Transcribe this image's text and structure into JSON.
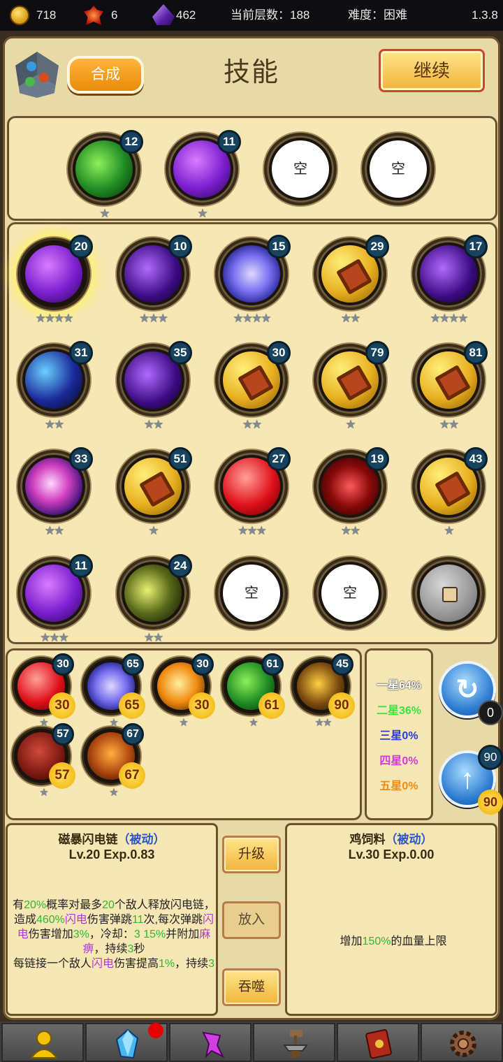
{
  "topbar": {
    "gold": "718",
    "fire_gems": "6",
    "crystals": "462",
    "floor_label": "当前层数：188",
    "difficulty_label": "难度：困难",
    "version": "1.3.8"
  },
  "header": {
    "synth_label": "合成",
    "title": "技能",
    "continue_label": "继续"
  },
  "equipped": [
    {
      "level": "12",
      "stars": "★",
      "style": "green"
    },
    {
      "level": "11",
      "stars": "★",
      "style": "purple"
    },
    {
      "empty": "空"
    },
    {
      "empty": "空"
    }
  ],
  "inventory": [
    {
      "level": "20",
      "stars": "★★★★",
      "style": "purple",
      "selected": true
    },
    {
      "level": "10",
      "stars": "★★★",
      "style": "darkpurple"
    },
    {
      "level": "15",
      "stars": "★★★★",
      "style": "blue"
    },
    {
      "level": "29",
      "stars": "★★",
      "style": "gold"
    },
    {
      "level": "17",
      "stars": "★★★★",
      "style": "darkpurple"
    },
    {
      "level": "31",
      "stars": "★★",
      "style": "darkblue"
    },
    {
      "level": "35",
      "stars": "★★",
      "style": "darkpurple"
    },
    {
      "level": "30",
      "stars": "★★",
      "style": "gold"
    },
    {
      "level": "79",
      "stars": "★",
      "style": "gold"
    },
    {
      "level": "81",
      "stars": "★★",
      "style": "gold"
    },
    {
      "level": "33",
      "stars": "★★",
      "style": "violet"
    },
    {
      "level": "51",
      "stars": "★",
      "style": "gold"
    },
    {
      "level": "27",
      "stars": "★★★",
      "style": "red"
    },
    {
      "level": "19",
      "stars": "★★",
      "style": "redblack"
    },
    {
      "level": "43",
      "stars": "★",
      "style": "gold"
    },
    {
      "level": "11",
      "stars": "★★★",
      "style": "purple"
    },
    {
      "level": "24",
      "stars": "★★",
      "style": "yellowblack"
    },
    {
      "empty": "空"
    },
    {
      "empty": "空"
    },
    {
      "locked": true
    }
  ],
  "materials": [
    {
      "level": "30",
      "count": "30",
      "stars": "★",
      "style": "red",
      "selected": true
    },
    {
      "level": "65",
      "count": "65",
      "stars": "★",
      "style": "blue"
    },
    {
      "level": "30",
      "count": "30",
      "stars": "★",
      "style": "orange"
    },
    {
      "level": "61",
      "count": "61",
      "stars": "★",
      "style": "green"
    },
    {
      "level": "45",
      "count": "90",
      "stars": "★★",
      "style": "brownyellow"
    },
    {
      "level": "57",
      "count": "57",
      "stars": "★",
      "style": "crimson"
    },
    {
      "level": "67",
      "count": "67",
      "stars": "★",
      "style": "cross"
    }
  ],
  "ratios": [
    {
      "label": "一星64%",
      "color": "#ffffff"
    },
    {
      "label": "二星36%",
      "color": "#3de33d"
    },
    {
      "label": "三星0%",
      "color": "#2a3ae0"
    },
    {
      "label": "四星0%",
      "color": "#d33ad8"
    },
    {
      "label": "五星0%",
      "color": "#f08a10"
    }
  ],
  "refresh": {
    "count": "0"
  },
  "upgrade": {
    "level": "90",
    "count": "90"
  },
  "detail_left": {
    "name": "磁暴闪电链",
    "passive": "（被动）",
    "lv": "Lv.20 Exp.0.83"
  },
  "detail_right": {
    "name": "鸡饲料",
    "passive": "（被动）",
    "lv": "Lv.30 Exp.0.00",
    "desc_a": "增加",
    "desc_b": "150%",
    "desc_c": "的血量上限"
  },
  "actions": {
    "upgrade": "升级",
    "place": "放入",
    "devour": "吞噬"
  },
  "colors": {
    "panel": "#e9d9a6",
    "box": "#f6e7b5",
    "border": "#6b5330",
    "highlight_green": "#2eb82e",
    "highlight_purple": "#b038d8"
  },
  "nav": [
    "user-icon",
    "gem-icon",
    "wand-icon",
    "anvil-icon",
    "book-icon",
    "gear-icon"
  ]
}
